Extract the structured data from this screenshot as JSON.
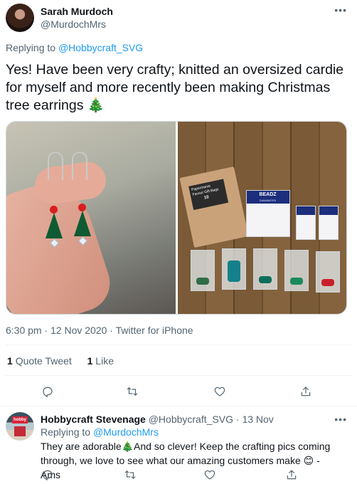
{
  "tweet": {
    "author_name": "Sarah Murdoch",
    "author_handle": "@MurdochMrs",
    "more_label": "•••",
    "replying_prefix": "Replying to ",
    "replying_to": "@Hobbycraft_SVG",
    "text": "Yes! Have been very crafty; knitted an oversized cardie for myself and more recently been making Christmas tree earrings 🎄",
    "timestamp": "6:30 pm · 12 Nov 2020 · Twitter for iPhone",
    "quote_count": "1",
    "quote_label": "Quote Tweet",
    "like_count": "1",
    "like_label": "Like",
    "bag_brand": "Papermania",
    "bag_title": "Favour Gift Bags",
    "bag_count": "10",
    "bead_card_brand": "BEADZ",
    "bead_card_sub": "DIAMANTES",
    "icons": [
      "reply-icon",
      "retweet-icon",
      "like-icon",
      "share-icon"
    ]
  },
  "reply": {
    "author_name": "Hobbycraft Stevenage",
    "author_handle": "@Hobbycraft_SVG",
    "separator": " · ",
    "date": "13 Nov",
    "replying_prefix": "Replying to ",
    "replying_to": "@MurdochMrs",
    "text": "They are adorable🎄And so clever! Keep the crafting pics coming through, we love to see what our amazing customers make 😊 - Ams",
    "more_label": "•••",
    "avatar_sign": "hobby"
  },
  "colors": {
    "accent": "#1d9bf0",
    "secondary_text": "#536471",
    "primary_text": "#0f1419",
    "divider": "#eff3f4"
  }
}
